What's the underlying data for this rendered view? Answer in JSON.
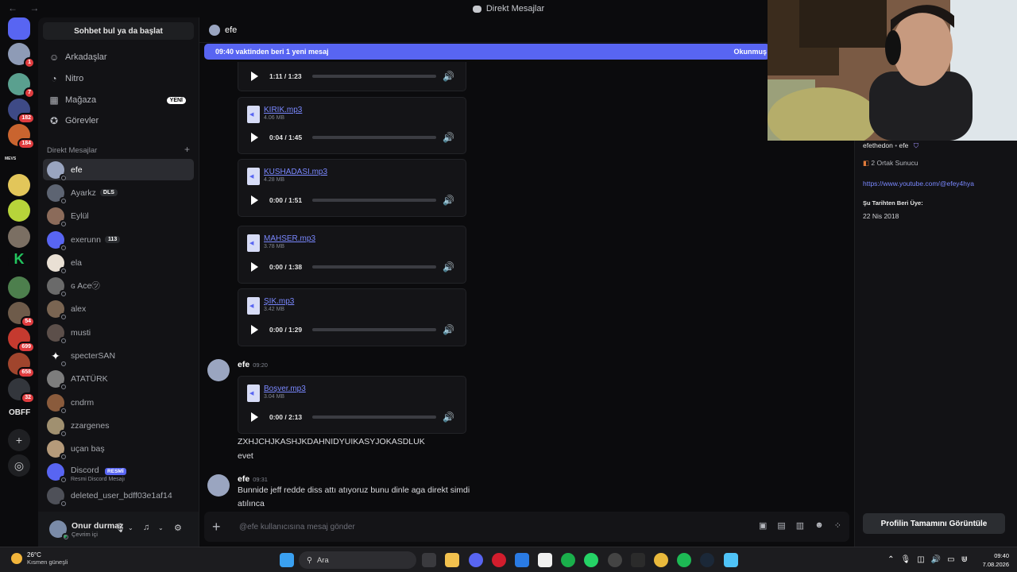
{
  "window": {
    "title": "Direkt Mesajlar"
  },
  "sidebar": {
    "search_label": "Sohbet bul ya da başlat",
    "nav": [
      {
        "label": "Arkadaşlar",
        "icon": "friends-icon"
      },
      {
        "label": "Nitro",
        "icon": "nitro-icon"
      },
      {
        "label": "Mağaza",
        "icon": "shop-icon",
        "tag": "YENİ"
      },
      {
        "label": "Görevler",
        "icon": "quests-icon"
      }
    ],
    "dm_header": "Direkt Mesajlar",
    "dm_add": "+",
    "dms": [
      {
        "name": "efe"
      },
      {
        "name": "Ayarkz",
        "tag": "DLS"
      },
      {
        "name": "Eylül"
      },
      {
        "name": "exerunn",
        "tag": "113"
      },
      {
        "name": "ela"
      },
      {
        "name": "ɢ Ace㋡"
      },
      {
        "name": "alex"
      },
      {
        "name": "musti"
      },
      {
        "name": "specterSAN"
      },
      {
        "name": "ATATÜRK"
      },
      {
        "name": "cndrm"
      },
      {
        "name": "zzargenes"
      },
      {
        "name": "uçan baş"
      },
      {
        "name": "Discord",
        "tag": "RESMİ",
        "sub": "Resmi Discord Mesajı"
      },
      {
        "name": "deleted_user_bdff03e1af14"
      }
    ]
  },
  "rail": {
    "badges": [
      "1",
      "7",
      "182",
      "184",
      "54",
      "699",
      "658",
      "32"
    ],
    "text_server_1": "MEVS",
    "text_server_2": "OBFF"
  },
  "user": {
    "name": "Onur durmaz",
    "status": "Çevrim içi"
  },
  "chat": {
    "channel": "efe",
    "banner": "09:40 vaktinden beri 1 yeni mesaj",
    "banner_action": "Okunmuş",
    "files": [
      {
        "name": "",
        "size": "",
        "time": "1:11 / 1:23",
        "progress": 0.86
      },
      {
        "name": "KIRIK.mp3",
        "size": "4.06 MB",
        "time": "0:04 / 1:45",
        "progress": 0.84
      },
      {
        "name": "KUSHADASI.mp3",
        "size": "4.28 MB",
        "time": "0:00 / 1:51",
        "progress": 0.56
      },
      {
        "name": "MAHSER.mp3",
        "size": "3.78 MB",
        "time": "0:00 / 1:38",
        "progress": 0.64
      },
      {
        "name": "ŞIK.mp3",
        "size": "3.42 MB",
        "time": "0:00 / 1:29",
        "progress": 0.7
      },
      {
        "name": "Boşver.mp3",
        "size": "3.04 MB",
        "time": "0:00 / 2:13",
        "progress": 0.06
      }
    ],
    "messages": [
      {
        "author": "efe",
        "time": "09:20",
        "lines": [
          "ZXHJCHJKASHJKDAHNIDYUIKASYJOKASDLUK",
          "evet"
        ]
      },
      {
        "author": "efe",
        "time": "09:31",
        "lines": [
          "Bunnide jeff redde diss attı atıyoruz bunu dinle aga direkt simdi",
          "atılınca"
        ]
      }
    ],
    "composer_placeholder": "@efe kullanıcısına mesaj gönder"
  },
  "profile": {
    "handle": "efethedon",
    "display": "efe",
    "mutual_servers": "2 Ortak Sunucu",
    "link": "https://www.youtube.com/@efey4hya",
    "member_since_label": "Şu Tarihten Beri Üye:",
    "member_since": "22 Nis 2018",
    "full_profile_button": "Profilin Tamamını Görüntüle"
  },
  "taskbar": {
    "temp": "26°C",
    "weather": "Kısmen güneşli",
    "search": "Ara",
    "time": "09:40",
    "date": "7.08.2026"
  }
}
